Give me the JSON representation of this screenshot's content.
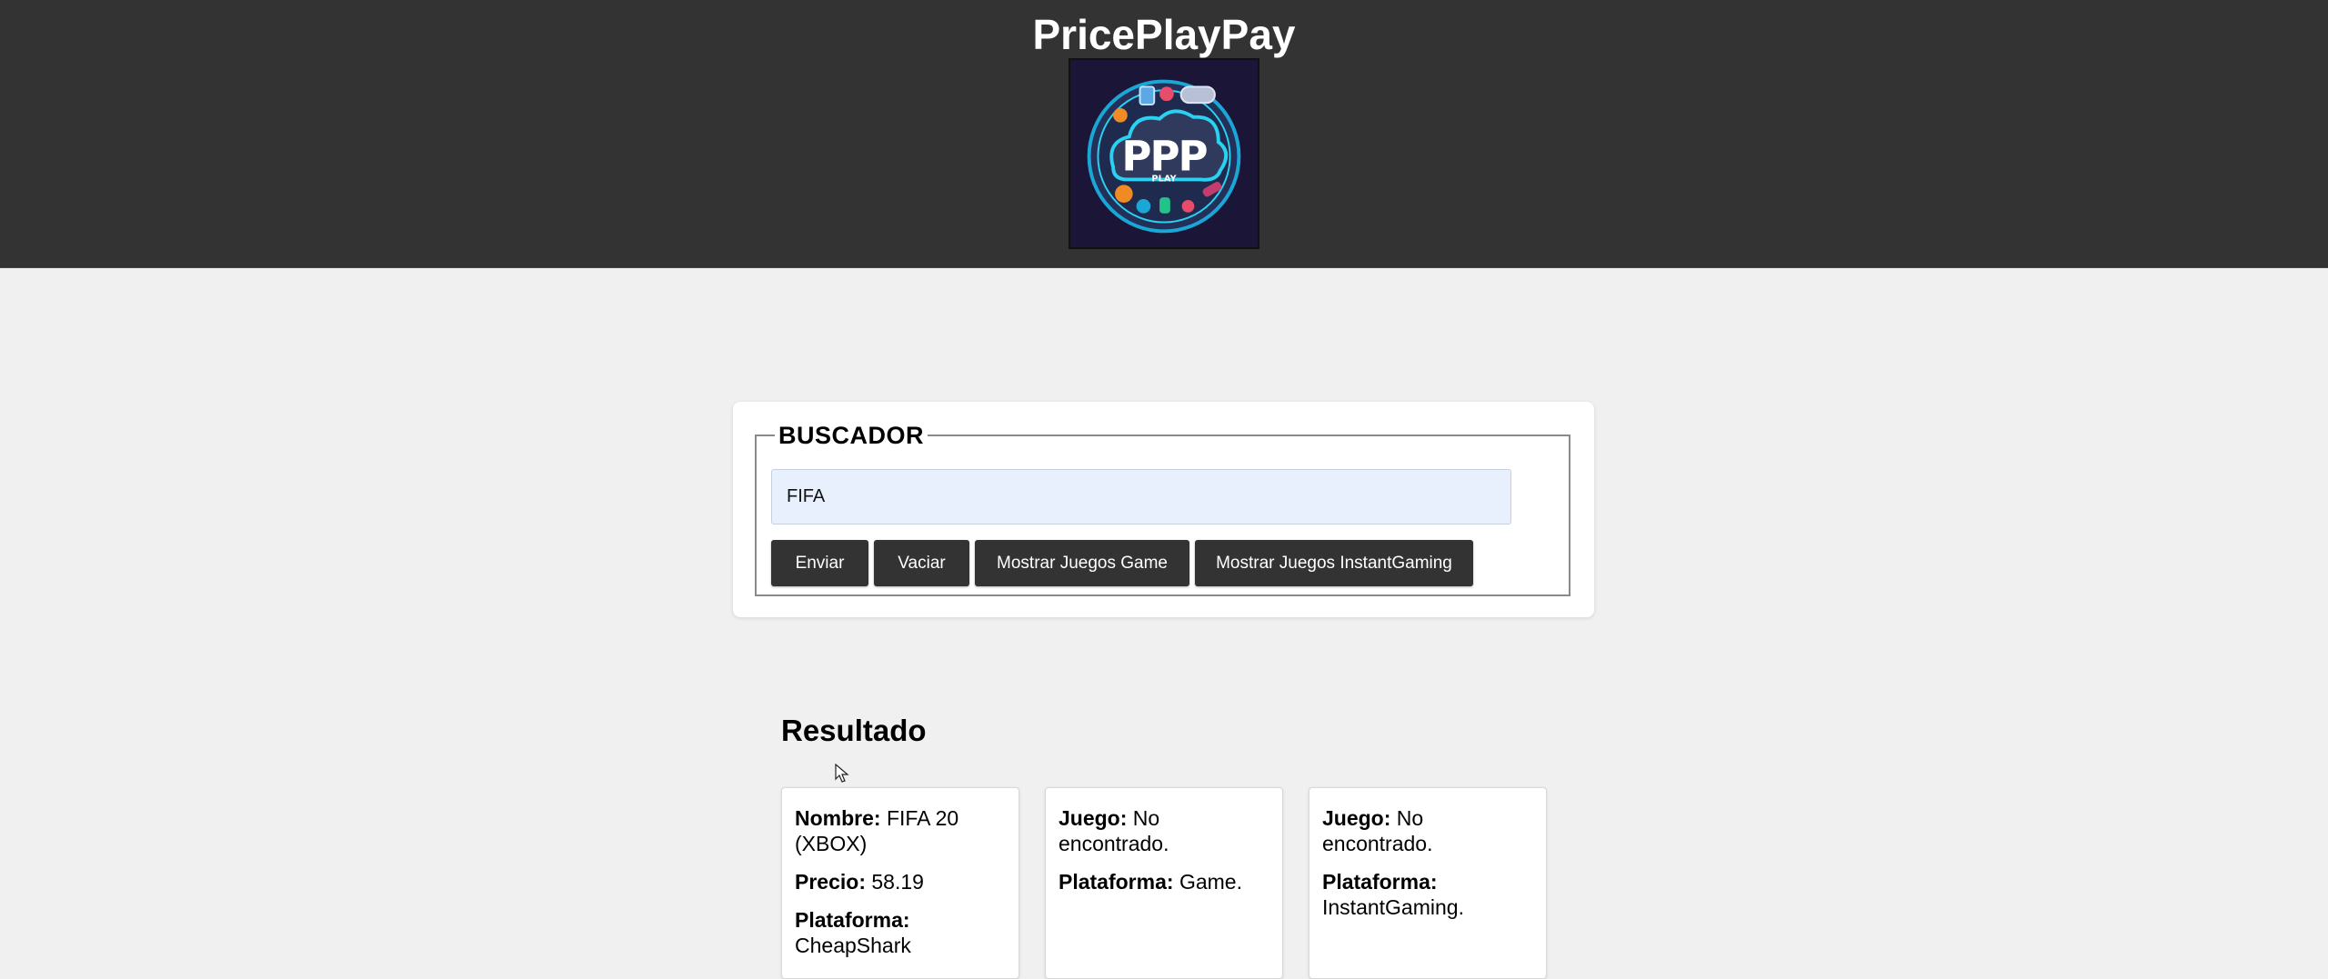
{
  "header": {
    "title": "PricePlayPay",
    "logo_text": "PPP",
    "logo_subtext": "PLAY"
  },
  "search": {
    "legend": "BUSCADOR",
    "input_value": "FIFA",
    "buttons": {
      "submit": "Enviar",
      "clear": "Vaciar",
      "show_game": "Mostrar Juegos Game",
      "show_instant": "Mostrar Juegos InstantGaming"
    }
  },
  "results": {
    "title": "Resultado",
    "cards": [
      {
        "name_label": "Nombre:",
        "name_value": "FIFA 20 (XBOX)",
        "price_label": "Precio:",
        "price_value": "58.19",
        "platform_label": "Plataforma:",
        "platform_value": "CheapShark"
      },
      {
        "game_label": "Juego:",
        "game_value": "No encontrado.",
        "platform_label": "Plataforma:",
        "platform_value": "Game."
      },
      {
        "game_label": "Juego:",
        "game_value": "No encontrado.",
        "platform_label": "Plataforma:",
        "platform_value": "InstantGaming."
      }
    ]
  },
  "colors": {
    "header_bg": "#333333",
    "page_bg": "#f0f0f0",
    "button_bg": "#333333",
    "input_bg": "#e8f0fe"
  }
}
